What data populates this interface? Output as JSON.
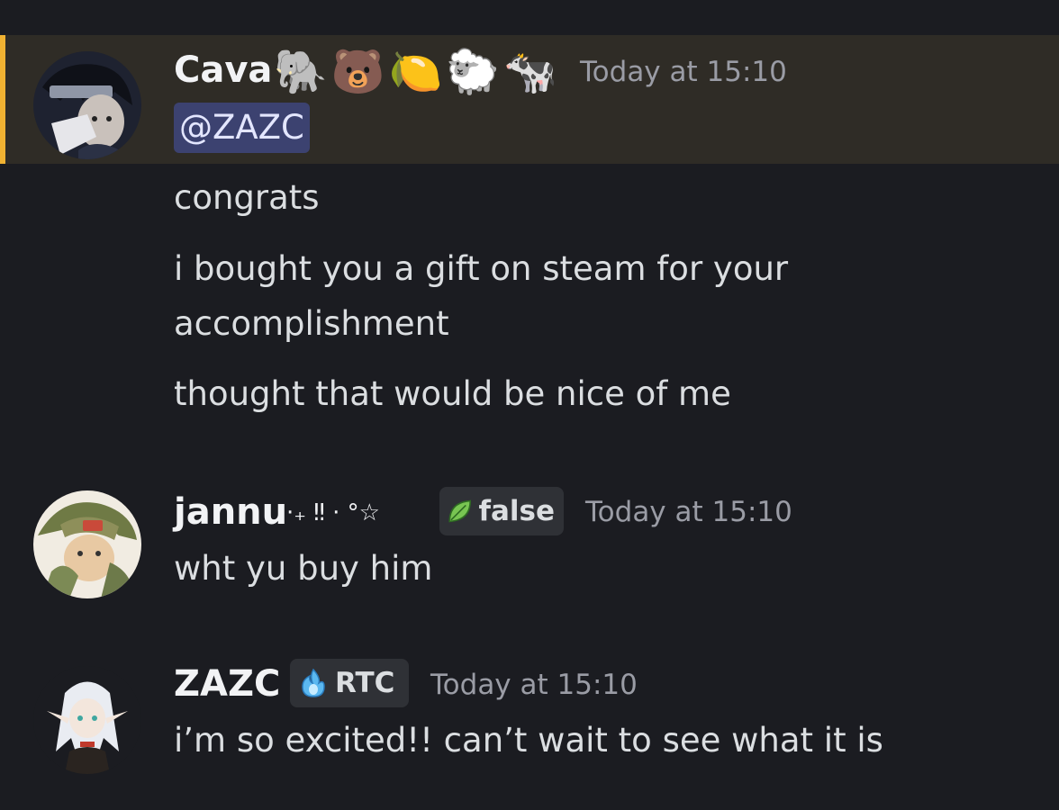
{
  "messages": {
    "cava": {
      "username": "Cava",
      "emojis": [
        "🐘",
        "🐻",
        "🍋",
        "🐑",
        "🐄"
      ],
      "timestamp": "Today at 15:10",
      "mention": "@ZAZC",
      "lines": [
        "congrats",
        "i bought you a gift on steam for your",
        "accomplishment",
        "thought that would be nice of me"
      ]
    },
    "jannu": {
      "username": "jannu",
      "decoration": "·₊ ‼  · °☆",
      "tag": "false",
      "tag_icon": "leaf-icon",
      "timestamp": "Today at 15:10",
      "lines": [
        "wht yu buy him"
      ]
    },
    "zazc": {
      "username": "ZAZC",
      "tag": "RTC",
      "tag_icon": "flame-icon",
      "timestamp": "Today at 15:10",
      "lines": [
        "i’m so excited!! can’t wait to see what it is"
      ]
    }
  },
  "colors": {
    "background": "#1b1c21",
    "highlight_background": "#2f2c26",
    "highlight_border": "#f0b232",
    "mention_background": "#3c4270",
    "timestamp": "#9a9ca5"
  }
}
